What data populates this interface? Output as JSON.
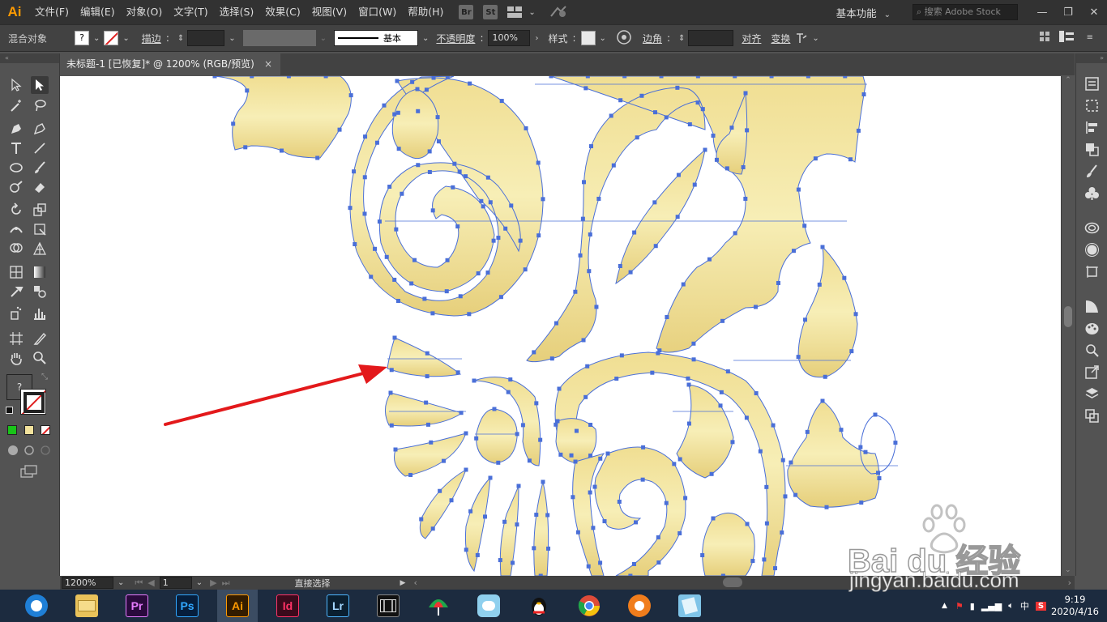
{
  "app": {
    "logo": "Ai",
    "brand_color": "#ff9a00"
  },
  "menubar": {
    "items": [
      "文件(F)",
      "编辑(E)",
      "对象(O)",
      "文字(T)",
      "选择(S)",
      "效果(C)",
      "视图(V)",
      "窗口(W)",
      "帮助(H)"
    ],
    "bridge": "Br",
    "stock": "St",
    "workspace": "基本功能",
    "search_placeholder": "搜索 Adobe Stock"
  },
  "control_bar": {
    "selection_label": "混合对象",
    "fill_value": "?",
    "stroke_label": "描边",
    "stroke_profile": "基本",
    "opacity_label": "不透明度",
    "opacity_value": "100%",
    "style_label": "样式",
    "corner_label": "边角",
    "align_label": "对齐",
    "transform_label": "变换"
  },
  "document": {
    "tab_title": "未标题-1 [已恢复]* @ 1200% (RGB/预览)",
    "close": "×"
  },
  "toolbar": {
    "fill_value": "?",
    "colors": {
      "green": "#19c419",
      "beige": "#f2e29c",
      "none_red": "#e02020"
    }
  },
  "status": {
    "zoom": "1200%",
    "artboard": "1",
    "tool_name": "直接选择"
  },
  "artwork": {
    "fill_color": "#efdd92",
    "path_color": "#4a6fd8",
    "arrow_color": "#e3191b"
  },
  "taskbar": {
    "apps": [
      {
        "name": "browser",
        "label": ""
      },
      {
        "name": "file-explorer",
        "label": ""
      },
      {
        "name": "premiere",
        "label": "Pr"
      },
      {
        "name": "photoshop",
        "label": "Ps"
      },
      {
        "name": "illustrator",
        "label": "Ai"
      },
      {
        "name": "indesign",
        "label": "Id"
      },
      {
        "name": "lightroom",
        "label": "Lr"
      },
      {
        "name": "video-editor",
        "label": ""
      },
      {
        "name": "umbrella-app",
        "label": ""
      },
      {
        "name": "chat-app",
        "label": ""
      },
      {
        "name": "qq",
        "label": ""
      },
      {
        "name": "chrome",
        "label": ""
      },
      {
        "name": "player",
        "label": ""
      },
      {
        "name": "notes",
        "label": ""
      }
    ],
    "ime": "中",
    "time": "9:19",
    "date": "2020/4/16"
  },
  "watermark": {
    "text": "Bai du 经验",
    "url": "jingyan.baidu.com"
  }
}
